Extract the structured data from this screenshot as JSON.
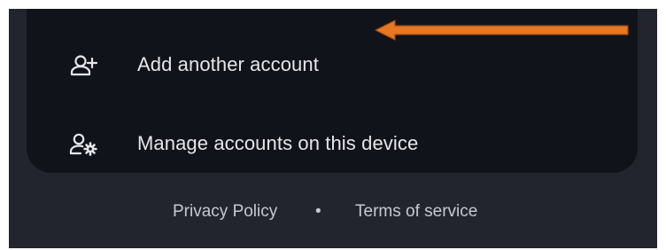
{
  "menu": {
    "items": [
      {
        "label": "Add another account",
        "icon": "person-add-icon"
      },
      {
        "label": "Manage accounts on this device",
        "icon": "manage-accounts-icon"
      }
    ]
  },
  "footer": {
    "privacy": "Privacy Policy",
    "separator": "•",
    "terms": "Terms of service"
  },
  "annotation": {
    "arrow_color": "#e87722",
    "points_to": "Add another account"
  },
  "colors": {
    "background": "#23252e",
    "card": "#11131b",
    "text": "#e6e6ea",
    "footer_text": "#c7c9d1"
  }
}
